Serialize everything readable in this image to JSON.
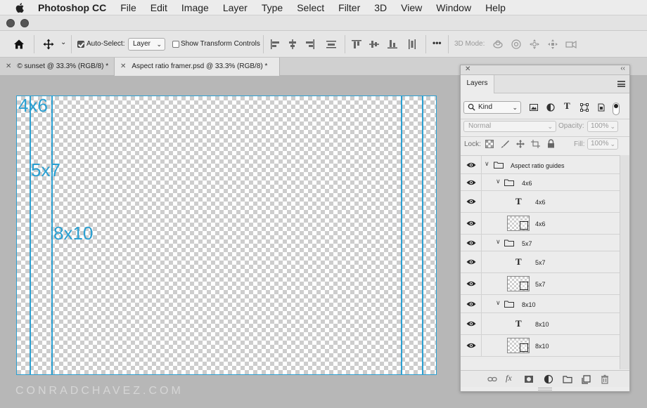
{
  "menubar": {
    "app_name": "Photoshop CC",
    "items": [
      "File",
      "Edit",
      "Image",
      "Layer",
      "Type",
      "Select",
      "Filter",
      "3D",
      "View",
      "Window",
      "Help"
    ]
  },
  "options": {
    "auto_select_label": "Auto-Select:",
    "auto_select_checked": true,
    "auto_select_value": "Layer",
    "transform_controls_label": "Show Transform Controls",
    "transform_controls_checked": false,
    "mode_3d_label": "3D Mode:",
    "more_glyph": "•••"
  },
  "tabs": [
    {
      "label": "© sunset @ 33.3% (RGB/8) *",
      "active": false
    },
    {
      "label": "Aspect ratio framer.psd @ 33.3% (RGB/8) *",
      "active": true
    }
  ],
  "canvas": {
    "labels": [
      "4x6",
      "5x7",
      "8x10"
    ],
    "guide_color": "#2ba0d2"
  },
  "watermark": "CONRADCHAVEZ.COM",
  "layers_panel": {
    "tab_label": "Layers",
    "kind_label": "Kind",
    "blend_mode": "Normal",
    "opacity_label": "Opacity:",
    "opacity_value": "100%",
    "lock_label": "Lock:",
    "fill_label": "Fill:",
    "fill_value": "100%",
    "layers": [
      {
        "type": "group",
        "name": "Aspect ratio guides",
        "depth": 0
      },
      {
        "type": "group",
        "name": "4x6",
        "depth": 1
      },
      {
        "type": "text",
        "name": "4x6",
        "depth": 2
      },
      {
        "type": "pixel",
        "name": "4x6",
        "depth": 2
      },
      {
        "type": "group",
        "name": "5x7",
        "depth": 1
      },
      {
        "type": "text",
        "name": "5x7",
        "depth": 2
      },
      {
        "type": "pixel",
        "name": "5x7",
        "depth": 2
      },
      {
        "type": "group",
        "name": "8x10",
        "depth": 1
      },
      {
        "type": "text",
        "name": "8x10",
        "depth": 2
      },
      {
        "type": "pixel",
        "name": "8x10",
        "depth": 2
      }
    ],
    "bottom_icons": [
      "link-icon",
      "fx-icon",
      "mask-icon",
      "adjustment-icon",
      "new-group-icon",
      "new-layer-icon",
      "trash-icon"
    ]
  }
}
